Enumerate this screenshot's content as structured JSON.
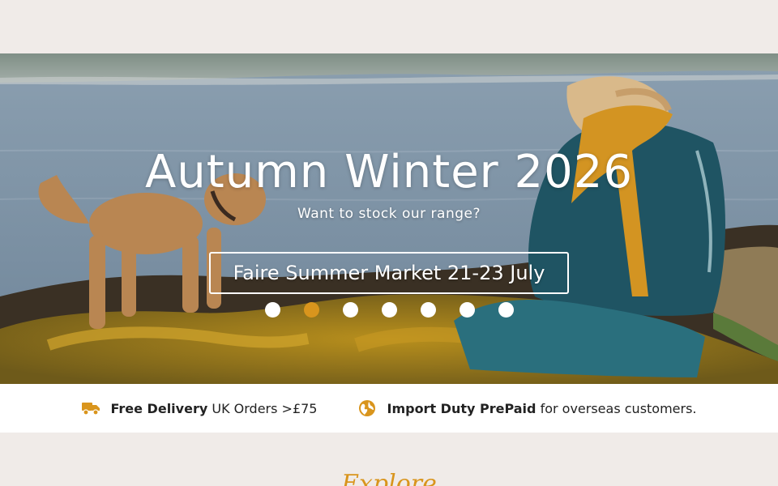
{
  "hero": {
    "title": "Autumn Winter 2026",
    "subtitle": "Want to stock our range?",
    "button_label": "Faire Summer Market 21-23 July",
    "slides": 7,
    "active_slide": 2
  },
  "info": {
    "delivery_bold": "Free Delivery",
    "delivery_text": "UK Orders >£75",
    "duty_bold": "Import Duty PrePaid",
    "duty_text": "for overseas customers.",
    "delivery_icon": "truck-icon",
    "duty_icon": "globe-icon"
  },
  "explore": {
    "heading": "Explore"
  },
  "colors": {
    "accent": "#d9951d",
    "page_bg": "#f0ebe8",
    "white": "#ffffff"
  }
}
